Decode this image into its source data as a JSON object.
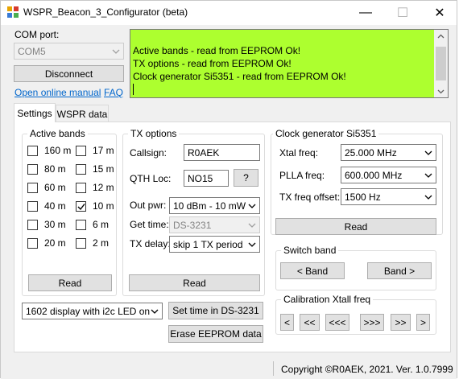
{
  "window": {
    "title": "WSPR_Beacon_3_Configurator (beta)",
    "minimize_glyph": "—",
    "maximize_glyph": "☐",
    "close_glyph": "✕"
  },
  "com": {
    "label": "COM port:",
    "value": "COM5",
    "disconnect": "Disconnect",
    "manual_link": "Open online manual",
    "faq_link": "FAQ"
  },
  "log": {
    "lines": [
      "Active bands - read from EEPROM Ok!",
      "TX options - read from EEPROM Ok!",
      "Clock generator Si5351 - read from EEPROM Ok!"
    ],
    "background": "#adff2f"
  },
  "tabs": [
    {
      "label": "Settings",
      "active": true
    },
    {
      "label": "WSPR data",
      "active": false
    }
  ],
  "active_bands": {
    "title": "Active bands",
    "bands": [
      {
        "label": "160 m",
        "checked": false
      },
      {
        "label": "17 m",
        "checked": false
      },
      {
        "label": "80 m",
        "checked": false
      },
      {
        "label": "15 m",
        "checked": false
      },
      {
        "label": "60 m",
        "checked": false
      },
      {
        "label": "12 m",
        "checked": false
      },
      {
        "label": "40 m",
        "checked": false
      },
      {
        "label": "10 m",
        "checked": true
      },
      {
        "label": "30 m",
        "checked": false
      },
      {
        "label": "6 m",
        "checked": false
      },
      {
        "label": "20 m",
        "checked": false
      },
      {
        "label": "2 m",
        "checked": false
      }
    ],
    "read": "Read"
  },
  "tx_options": {
    "title": "TX options",
    "callsign_label": "Callsign:",
    "callsign": "R0AEK",
    "qth_label": "QTH Loc:",
    "qth": "NO15",
    "qth_help": "?",
    "outpwr_label": "Out pwr:",
    "outpwr": "10 dBm - 10 mW",
    "gettime_label": "Get time:",
    "gettime": "DS-3231",
    "txdelay_label": "TX delay:",
    "txdelay": "skip 1 TX period",
    "read": "Read"
  },
  "clock": {
    "title": "Clock generator Si5351",
    "xtal_label": "Xtal freq:",
    "xtal": "25.000 MHz",
    "plla_label": "PLLA freq:",
    "plla": "600.000 MHz",
    "offset_label": "TX freq offset:",
    "offset": "1500 Hz",
    "read": "Read"
  },
  "switch_band": {
    "title": "Switch band",
    "prev": "< Band",
    "next": "Band >"
  },
  "calibration": {
    "title": "Calibration Xtall freq",
    "buttons": [
      "<",
      "<<",
      "<<<",
      ">>>",
      ">>",
      ">"
    ]
  },
  "bottom": {
    "display": "1602 display with i2c LED on",
    "set_time": "Set time in DS-3231",
    "erase": "Erase EEPROM data"
  },
  "status": {
    "copyright": "Copyright ©R0AEK, 2021. Ver. 1.0.7999"
  }
}
